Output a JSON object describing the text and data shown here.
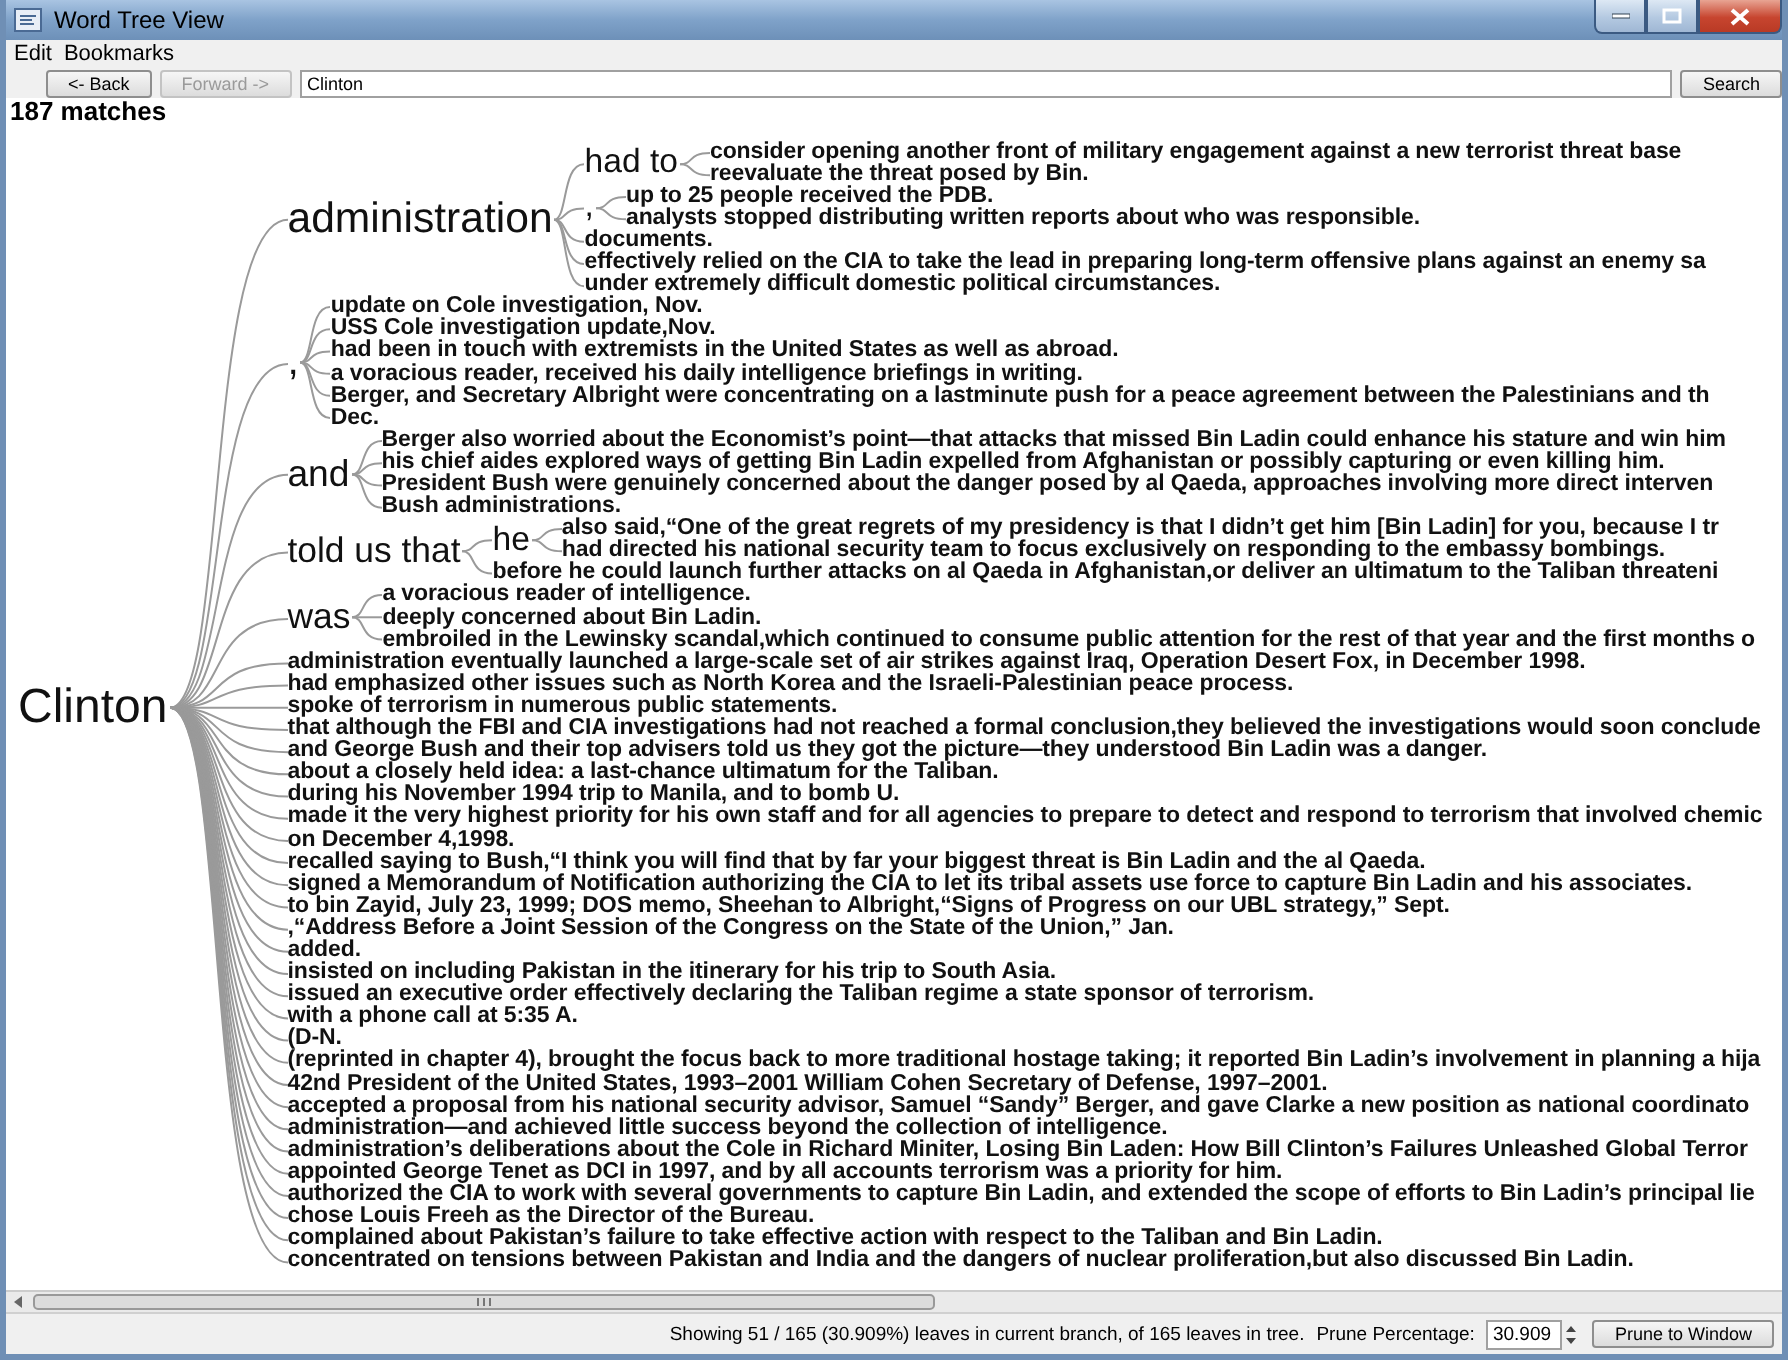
{
  "window": {
    "title": "Word Tree View"
  },
  "menu": [
    {
      "label": "Edit"
    },
    {
      "label": "Bookmarks"
    }
  ],
  "toolbar": {
    "back": {
      "label": "<- Back",
      "disabled": false
    },
    "forward": {
      "label": "Forward ->",
      "disabled": true
    },
    "query": "Clinton",
    "search": "Search"
  },
  "match_count": "187 matches",
  "tree": {
    "text": "Clinton",
    "children": [
      {
        "text": "administration",
        "children": [
          {
            "text": "had to",
            "children": [
              {
                "text": "consider opening another front of military engagement against a new terrorist threat base"
              },
              {
                "text": "reevaluate the threat posed by Bin."
              }
            ]
          },
          {
            "text": ",",
            "children": [
              {
                "text": "up to 25 people received the PDB."
              },
              {
                "text": "analysts stopped distributing written reports about who was responsible."
              }
            ]
          },
          {
            "text": "documents."
          },
          {
            "text": "effectively relied on the CIA to take the lead in preparing long-term offensive plans against an enemy sa"
          },
          {
            "text": "under extremely difficult domestic political circumstances."
          }
        ]
      },
      {
        "text": ",",
        "children": [
          {
            "text": "update on Cole investigation, Nov."
          },
          {
            "text": "USS Cole investigation update,Nov."
          },
          {
            "text": "had been in touch with extremists in the United States as well as abroad."
          },
          {
            "text": "a voracious reader, received his daily intelligence briefings in writing."
          },
          {
            "text": "Berger, and Secretary Albright were concentrating on a lastminute push for a peace agreement between the Palestinians and th"
          },
          {
            "text": "Dec."
          }
        ]
      },
      {
        "text": "and",
        "children": [
          {
            "text": "Berger also worried about the Economist’s point—that attacks that missed Bin Ladin could enhance his stature and win him"
          },
          {
            "text": "his chief aides explored ways of getting Bin Ladin expelled from Afghanistan or possibly capturing or even killing him."
          },
          {
            "text": "President Bush were genuinely concerned about the danger posed by al Qaeda, approaches involving more direct interven"
          },
          {
            "text": "Bush administrations."
          }
        ]
      },
      {
        "text": "told us that",
        "children": [
          {
            "text": "he",
            "children": [
              {
                "text": "also said,“One of the great regrets of my presidency is that I didn’t get him [Bin Ladin] for you, because I tr"
              },
              {
                "text": "had directed his national security team to focus exclusively on responding to the embassy bombings."
              }
            ]
          },
          {
            "text": "before he could launch further attacks on al Qaeda in Afghanistan,or deliver an ultimatum to the Taliban threateni"
          }
        ]
      },
      {
        "text": "was",
        "children": [
          {
            "text": "a voracious reader of intelligence."
          },
          {
            "text": "deeply concerned about Bin Ladin."
          },
          {
            "text": "embroiled in the Lewinsky scandal,which continued to consume public attention for the rest of that year and the first months o"
          }
        ]
      },
      {
        "text": "administration eventually launched a large-scale set of air strikes against Iraq, Operation Desert Fox, in December 1998."
      },
      {
        "text": "had emphasized other issues such as North Korea and the Israeli-Palestinian peace process."
      },
      {
        "text": "spoke of terrorism in numerous public statements."
      },
      {
        "text": "that although the FBI and CIA investigations had not reached a formal conclusion,they believed the investigations would soon conclude"
      },
      {
        "text": "and George Bush and their top advisers told us they got the picture—they understood Bin Ladin was a danger."
      },
      {
        "text": "about a closely held idea: a last-chance ultimatum for the Taliban."
      },
      {
        "text": "during his November 1994 trip to Manila, and to bomb U."
      },
      {
        "text": "made it the very highest priority for his own staff and for all agencies to prepare to detect and respond to terrorism that involved chemic"
      },
      {
        "text": "on December 4,1998."
      },
      {
        "text": "recalled saying to Bush,“I think you will find that by far your biggest threat is Bin Ladin and the al Qaeda."
      },
      {
        "text": "signed a Memorandum of Notification authorizing the CIA to let its tribal assets use force to capture Bin Ladin and his associates."
      },
      {
        "text": "to bin Zayid, July 23, 1999; DOS memo, Sheehan to Albright,“Signs of Progress on our UBL strategy,” Sept."
      },
      {
        "text": ",“Address Before a Joint Session of the Congress on the State of the Union,” Jan."
      },
      {
        "text": "added."
      },
      {
        "text": "insisted on including Pakistan in the itinerary for his trip to South Asia."
      },
      {
        "text": "issued an executive order effectively declaring the Taliban regime a state sponsor of terrorism."
      },
      {
        "text": "with a phone call at 5:35 A."
      },
      {
        "text": "(D-N."
      },
      {
        "text": "(reprinted in chapter 4), brought the focus back to more traditional hostage taking; it reported Bin Ladin’s involvement in planning a hija"
      },
      {
        "text": "42nd President of the United States, 1993–2001 William Cohen Secretary of Defense, 1997–2001."
      },
      {
        "text": "accepted a proposal from his national security advisor, Samuel “Sandy” Berger, and gave Clarke a new position as national coordinato"
      },
      {
        "text": "administration—and achieved little success beyond the collection of intelligence."
      },
      {
        "text": "administration’s deliberations about the Cole in Richard Miniter, Losing Bin Laden: How Bill Clinton’s Failures Unleashed Global Terror"
      },
      {
        "text": "appointed George Tenet as DCI in 1997, and by all accounts terrorism was a priority for him."
      },
      {
        "text": "authorized the CIA to work with several governments to capture Bin Ladin, and extended the scope of efforts to Bin Ladin’s principal lie"
      },
      {
        "text": "chose Louis Freeh as the Director of the Bureau."
      },
      {
        "text": "complained about Pakistan’s failure to take effective action with respect to the Taliban and Bin Ladin."
      },
      {
        "text": "concentrated on tensions between Pakistan and India and the dangers of nuclear proliferation,but also discussed Bin Ladin."
      }
    ]
  },
  "status_bar": {
    "summary": "Showing 51 / 165 (30.909%) leaves in current branch, of 165 leaves in tree.",
    "prune_label": "Prune Percentage:",
    "prune_value": "30.909",
    "prune_button": "Prune to Window"
  }
}
